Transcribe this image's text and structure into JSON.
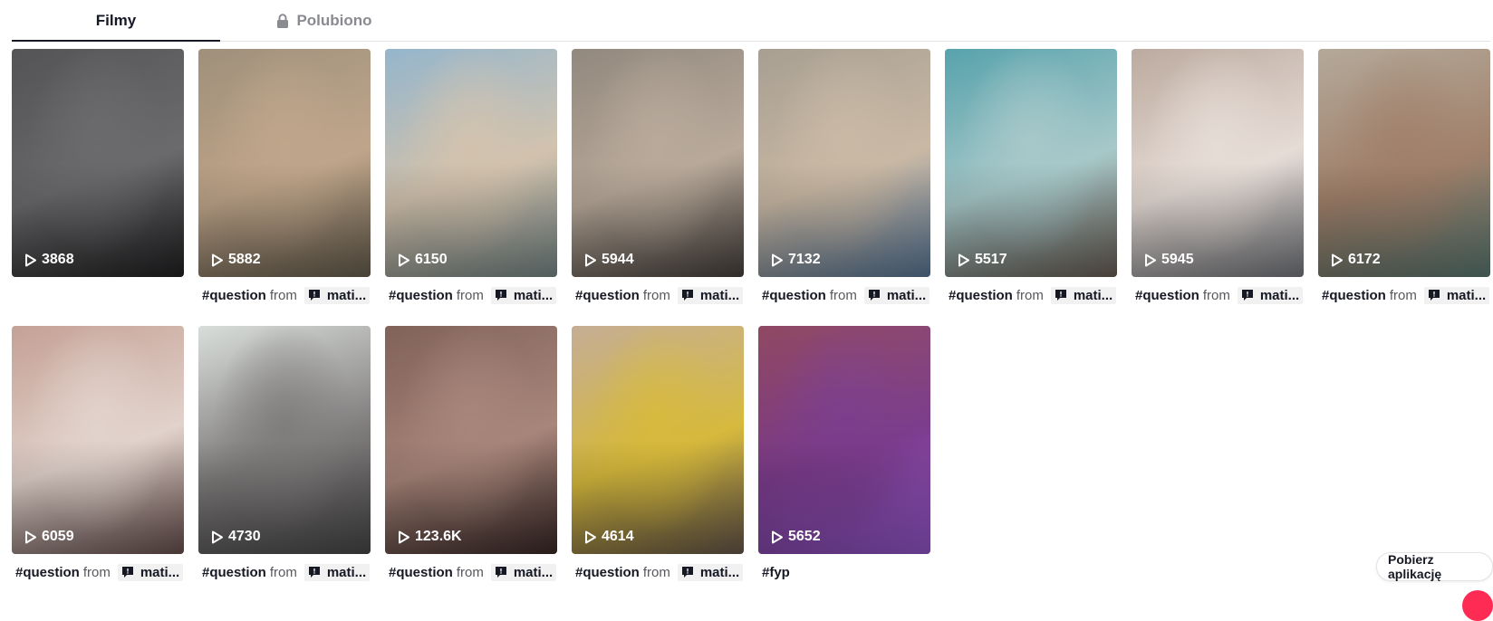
{
  "tabs": {
    "videos_label": "Filmy",
    "liked_label": "Polubiono"
  },
  "caption_from": "from",
  "videos": [
    {
      "views": "3868",
      "hashtag": "",
      "mention": "",
      "colors": [
        "#4b4b4d",
        "#6a6a6c",
        "#232325"
      ]
    },
    {
      "views": "5882",
      "hashtag": "#question",
      "mention": "mati...",
      "colors": [
        "#9a8a74",
        "#bfa58a",
        "#6c6352"
      ]
    },
    {
      "views": "6150",
      "hashtag": "#question",
      "mention": "mati...",
      "colors": [
        "#8fb2c9",
        "#d2c2ad",
        "#7d8f8f"
      ]
    },
    {
      "views": "5944",
      "hashtag": "#question",
      "mention": "mati...",
      "colors": [
        "#8c8277",
        "#b8a99a",
        "#4a4440"
      ]
    },
    {
      "views": "7132",
      "hashtag": "#question",
      "mention": "mati...",
      "colors": [
        "#a39a8c",
        "#c9b8a4",
        "#5d7ea0"
      ]
    },
    {
      "views": "5517",
      "hashtag": "#question",
      "mention": "mati...",
      "colors": [
        "#4f9ea8",
        "#a7c8c9",
        "#6e6258"
      ]
    },
    {
      "views": "5945",
      "hashtag": "#question",
      "mention": "mati...",
      "colors": [
        "#b8a69a",
        "#e6dcd6",
        "#7b7e84"
      ]
    },
    {
      "views": "6172",
      "hashtag": "#question",
      "mention": "mati...",
      "colors": [
        "#b0a494",
        "#a0806a",
        "#5f7f78"
      ]
    },
    {
      "views": "6059",
      "hashtag": "#question",
      "mention": "mati...",
      "colors": [
        "#c29c90",
        "#e1d2cb",
        "#6d5451"
      ]
    },
    {
      "views": "4730",
      "hashtag": "#question",
      "mention": "mati...",
      "colors": [
        "#d7dcd8",
        "#7f7c7c",
        "#4c4b4b"
      ]
    },
    {
      "views": "123.6K",
      "hashtag": "#question",
      "mention": "mati...",
      "colors": [
        "#7a5a50",
        "#a7857a",
        "#3c2a28"
      ]
    },
    {
      "views": "4614",
      "hashtag": "#question",
      "mention": "mati...",
      "colors": [
        "#c2a98f",
        "#d6b93c",
        "#6a5b4d"
      ]
    },
    {
      "views": "5652",
      "hashtag": "#fyp",
      "mention": "",
      "colors": [
        "#8a3f5a",
        "#7b3c8c",
        "#9b5bd7"
      ]
    }
  ],
  "get_app_label": "Pobierz aplikację",
  "accent": "#fe2c55"
}
